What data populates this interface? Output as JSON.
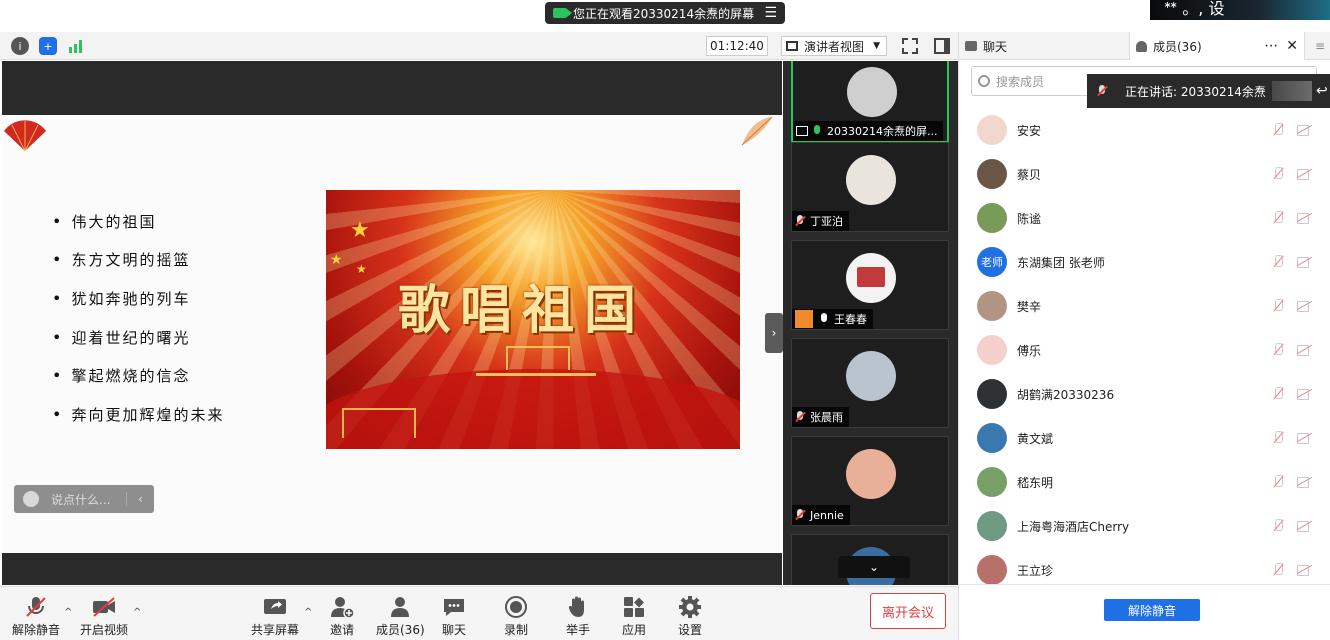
{
  "banner": {
    "text": "您正在观看20330214余焘的屏幕",
    "menu_icon": "menu-icon"
  },
  "corner_thumb": {
    "text": "ᕯ 。, 设"
  },
  "topbar": {
    "timer": "01:12:40",
    "view_mode": "演讲者视图",
    "icons": [
      "info-icon",
      "shield-icon",
      "signal-icon",
      "fullscreen-icon",
      "sidebar-toggle-icon"
    ]
  },
  "slide": {
    "bullets": [
      "伟大的祖国",
      "东方文明的摇篮",
      "犹如奔驰的列车",
      "迎着世纪的曙光",
      "擎起燃烧的信念",
      "奔向更加辉煌的未来"
    ],
    "poster_title": "歌唱祖国"
  },
  "chat_input": {
    "placeholder": "说点什么...",
    "collapse": "‹"
  },
  "thumbnails": [
    {
      "name": "20330214余焘的屏...",
      "status": "mic-on",
      "active": true,
      "color": "#cfcfcf"
    },
    {
      "name": "丁亚泊",
      "status": "mic-off",
      "active": false,
      "color": "#e9e4dc"
    },
    {
      "name": "王春春",
      "status": "mic-on",
      "active": false,
      "color": "#c23a3a"
    },
    {
      "name": "张晨雨",
      "status": "mic-off",
      "active": false,
      "color": "#b9c4cf"
    },
    {
      "name": "Jennie",
      "status": "mic-off",
      "active": false,
      "color": "#e8b098"
    },
    {
      "name": "",
      "status": "",
      "active": false,
      "color": "#3b6ea0"
    }
  ],
  "toolbar": {
    "unmute": "解除静音",
    "start_video": "开启视频",
    "share": "共享屏幕",
    "invite": "邀请",
    "members": "成员(36)",
    "chat": "聊天",
    "record": "录制",
    "raise_hand": "举手",
    "apps": "应用",
    "settings": "设置",
    "leave": "离开会议"
  },
  "panel": {
    "tab_chat": "聊天",
    "tab_members": "成员(36)",
    "search_placeholder": "搜索成员",
    "speaking": "正在讲话: 20330214余焘",
    "members": [
      {
        "name": "安安",
        "avatar": "#f0d8cf"
      },
      {
        "name": "蔡贝",
        "avatar": "#6b5646"
      },
      {
        "name": "陈谧",
        "avatar": "#7a9a5a"
      },
      {
        "name": "东湖集团 张老师",
        "avatar": "teacher",
        "avatar_text": "老师"
      },
      {
        "name": "樊辛",
        "avatar": "#b29484"
      },
      {
        "name": "傅乐",
        "avatar": "#f3d0cc"
      },
      {
        "name": "胡鹤满20330236",
        "avatar": "#2e3133"
      },
      {
        "name": "黄文斌",
        "avatar": "#3a78b0"
      },
      {
        "name": "嵇东明",
        "avatar": "#7aa06a"
      },
      {
        "name": "上海粤海酒店Cherry",
        "avatar": "#6e9a84"
      },
      {
        "name": "王立珍",
        "avatar": "#b8706a"
      }
    ],
    "unmute_all": "解除静音"
  }
}
